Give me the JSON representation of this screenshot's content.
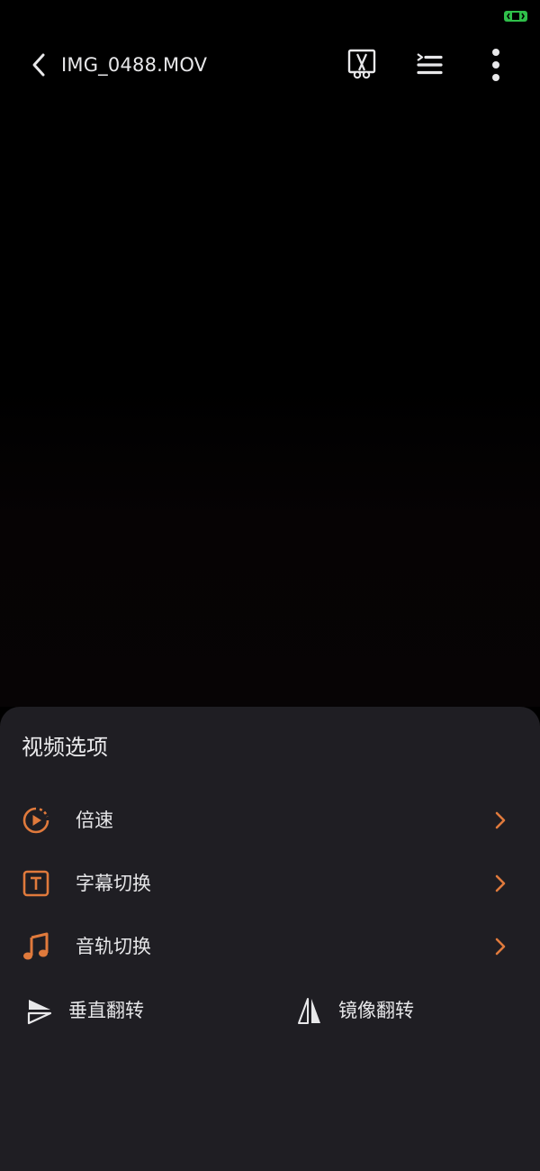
{
  "status": {
    "indicator_color": "#2fbf4a"
  },
  "topbar": {
    "title": "IMG_0488.MOV",
    "icons": [
      "back-icon",
      "scissors-cut-icon",
      "playlist-icon",
      "more-vertical-icon"
    ]
  },
  "sheet": {
    "title": "视频选项",
    "accent_color": "#e07a3c",
    "items": [
      {
        "label": "倍速",
        "icon": "playback-speed-icon"
      },
      {
        "label": "字幕切换",
        "icon": "subtitle-icon"
      },
      {
        "label": "音轨切换",
        "icon": "music-note-icon"
      }
    ],
    "flip_vertical_label": "垂直翻转",
    "flip_mirror_label": "镜像翻转"
  }
}
